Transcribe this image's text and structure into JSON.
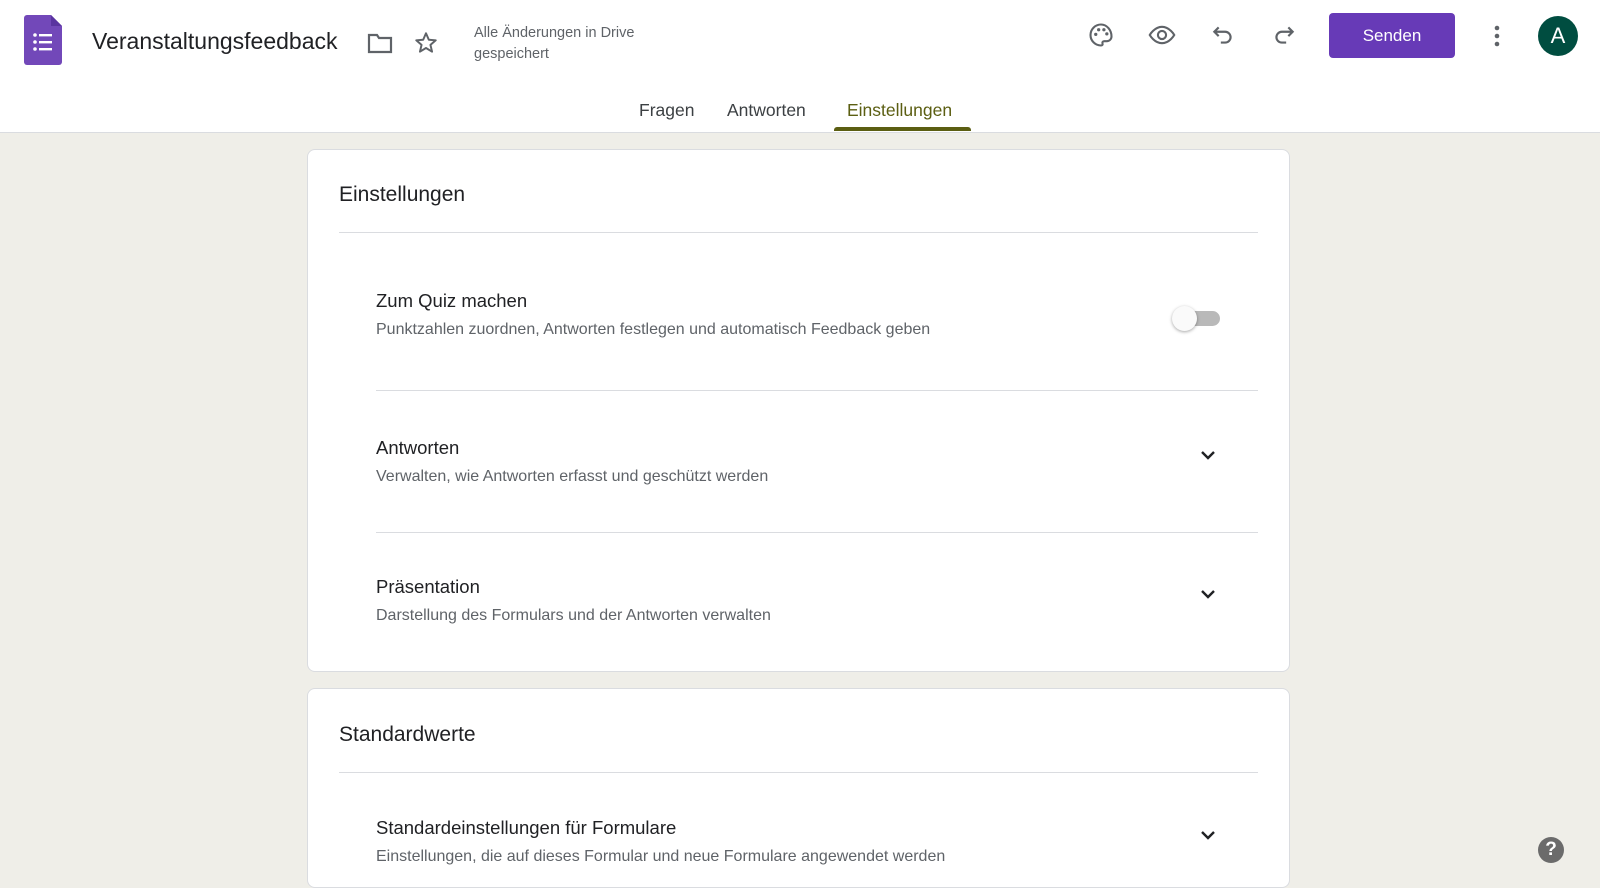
{
  "header": {
    "title": "Veranstaltungsfeedback",
    "saved_status": "Alle Änderungen in Drive gespeichert",
    "send_label": "Senden",
    "avatar_initial": "A"
  },
  "tabs": [
    {
      "label": "Fragen"
    },
    {
      "label": "Antworten"
    },
    {
      "label": "Einstellungen",
      "active": true
    }
  ],
  "settings": {
    "heading": "Einstellungen",
    "items": [
      {
        "title": "Zum Quiz machen",
        "description": "Punktzahlen zuordnen, Antworten festlegen und automatisch Feedback geben",
        "toggle_on": false
      },
      {
        "title": "Antworten",
        "description": "Verwalten, wie Antworten erfasst und geschützt werden"
      },
      {
        "title": "Präsentation",
        "description": "Darstellung des Formulars und der Antworten verwalten"
      }
    ]
  },
  "defaults": {
    "heading": "Standardwerte",
    "items": [
      {
        "title": "Standardeinstellungen für Formulare",
        "description": "Einstellungen, die auf dieses Formular und neue Formulare angewendet werden"
      }
    ]
  },
  "help": {
    "label": "?"
  },
  "colors": {
    "accent": "#673ab7",
    "tab_active": "#5b5e12",
    "background": "#efeee8",
    "avatar": "#004d40"
  }
}
